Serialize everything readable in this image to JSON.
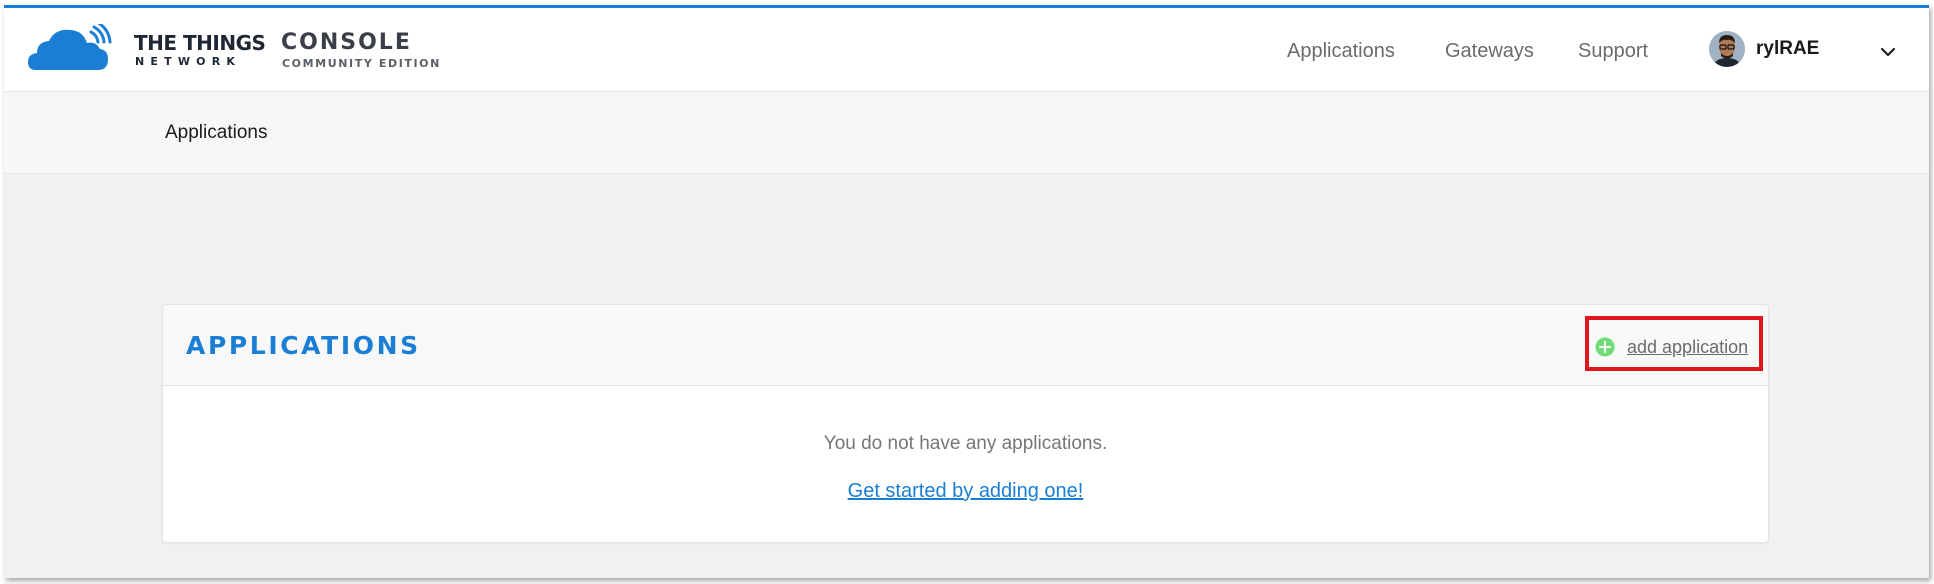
{
  "header": {
    "brand_main": "THE THINGS",
    "brand_sub": "NETWORK",
    "console_main": "CONSOLE",
    "console_sub": "COMMUNITY EDITION",
    "nav": [
      {
        "label": "Applications"
      },
      {
        "label": "Gateways"
      },
      {
        "label": "Support"
      }
    ],
    "user": {
      "name": "rylRAE",
      "avatar_icon": "user-avatar",
      "menu_icon": "chevron-down-icon"
    }
  },
  "breadcrumb": {
    "current": "Applications"
  },
  "card": {
    "title": "APPLICATIONS",
    "add_label": "add application",
    "add_icon": "plus-circle-icon",
    "empty_message": "You do not have any applications.",
    "get_started_label": "Get started by adding one!"
  },
  "colors": {
    "accent": "#1a7fd4",
    "add_icon": "#6fdc77",
    "highlight_box": "#e0161c"
  }
}
